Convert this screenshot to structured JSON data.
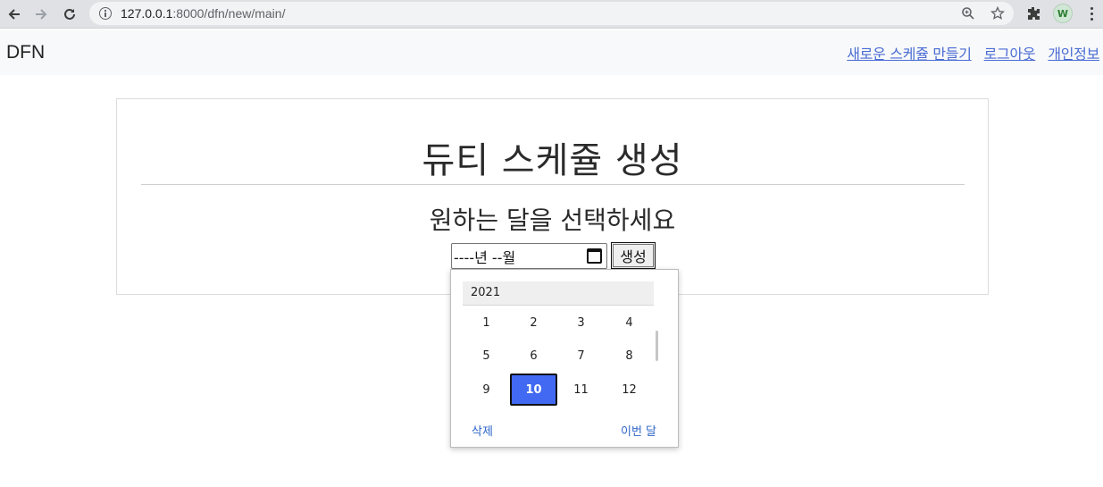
{
  "browser": {
    "url_host": "127.0.0.1",
    "url_path": ":8000/dfn/new/main/",
    "profile_initial": "W"
  },
  "navbar": {
    "brand": "DFN",
    "links": [
      "새로운 스케쥴 만들기",
      "로그아웃",
      "개인정보"
    ]
  },
  "card": {
    "title": "듀티 스케쥴 생성",
    "subtitle": "원하는 달을 선택하세요",
    "month_input_value": "----년 --월",
    "create_button": "생성"
  },
  "picker": {
    "year": "2021",
    "months": [
      "1",
      "2",
      "3",
      "4",
      "5",
      "6",
      "7",
      "8",
      "9",
      "10",
      "11",
      "12"
    ],
    "selected_month": "10",
    "clear_label": "삭제",
    "this_month_label": "이번 달"
  },
  "colors": {
    "link": "#4a6cd4",
    "selected": "#4169f2",
    "picker_action": "#2f66c9"
  }
}
